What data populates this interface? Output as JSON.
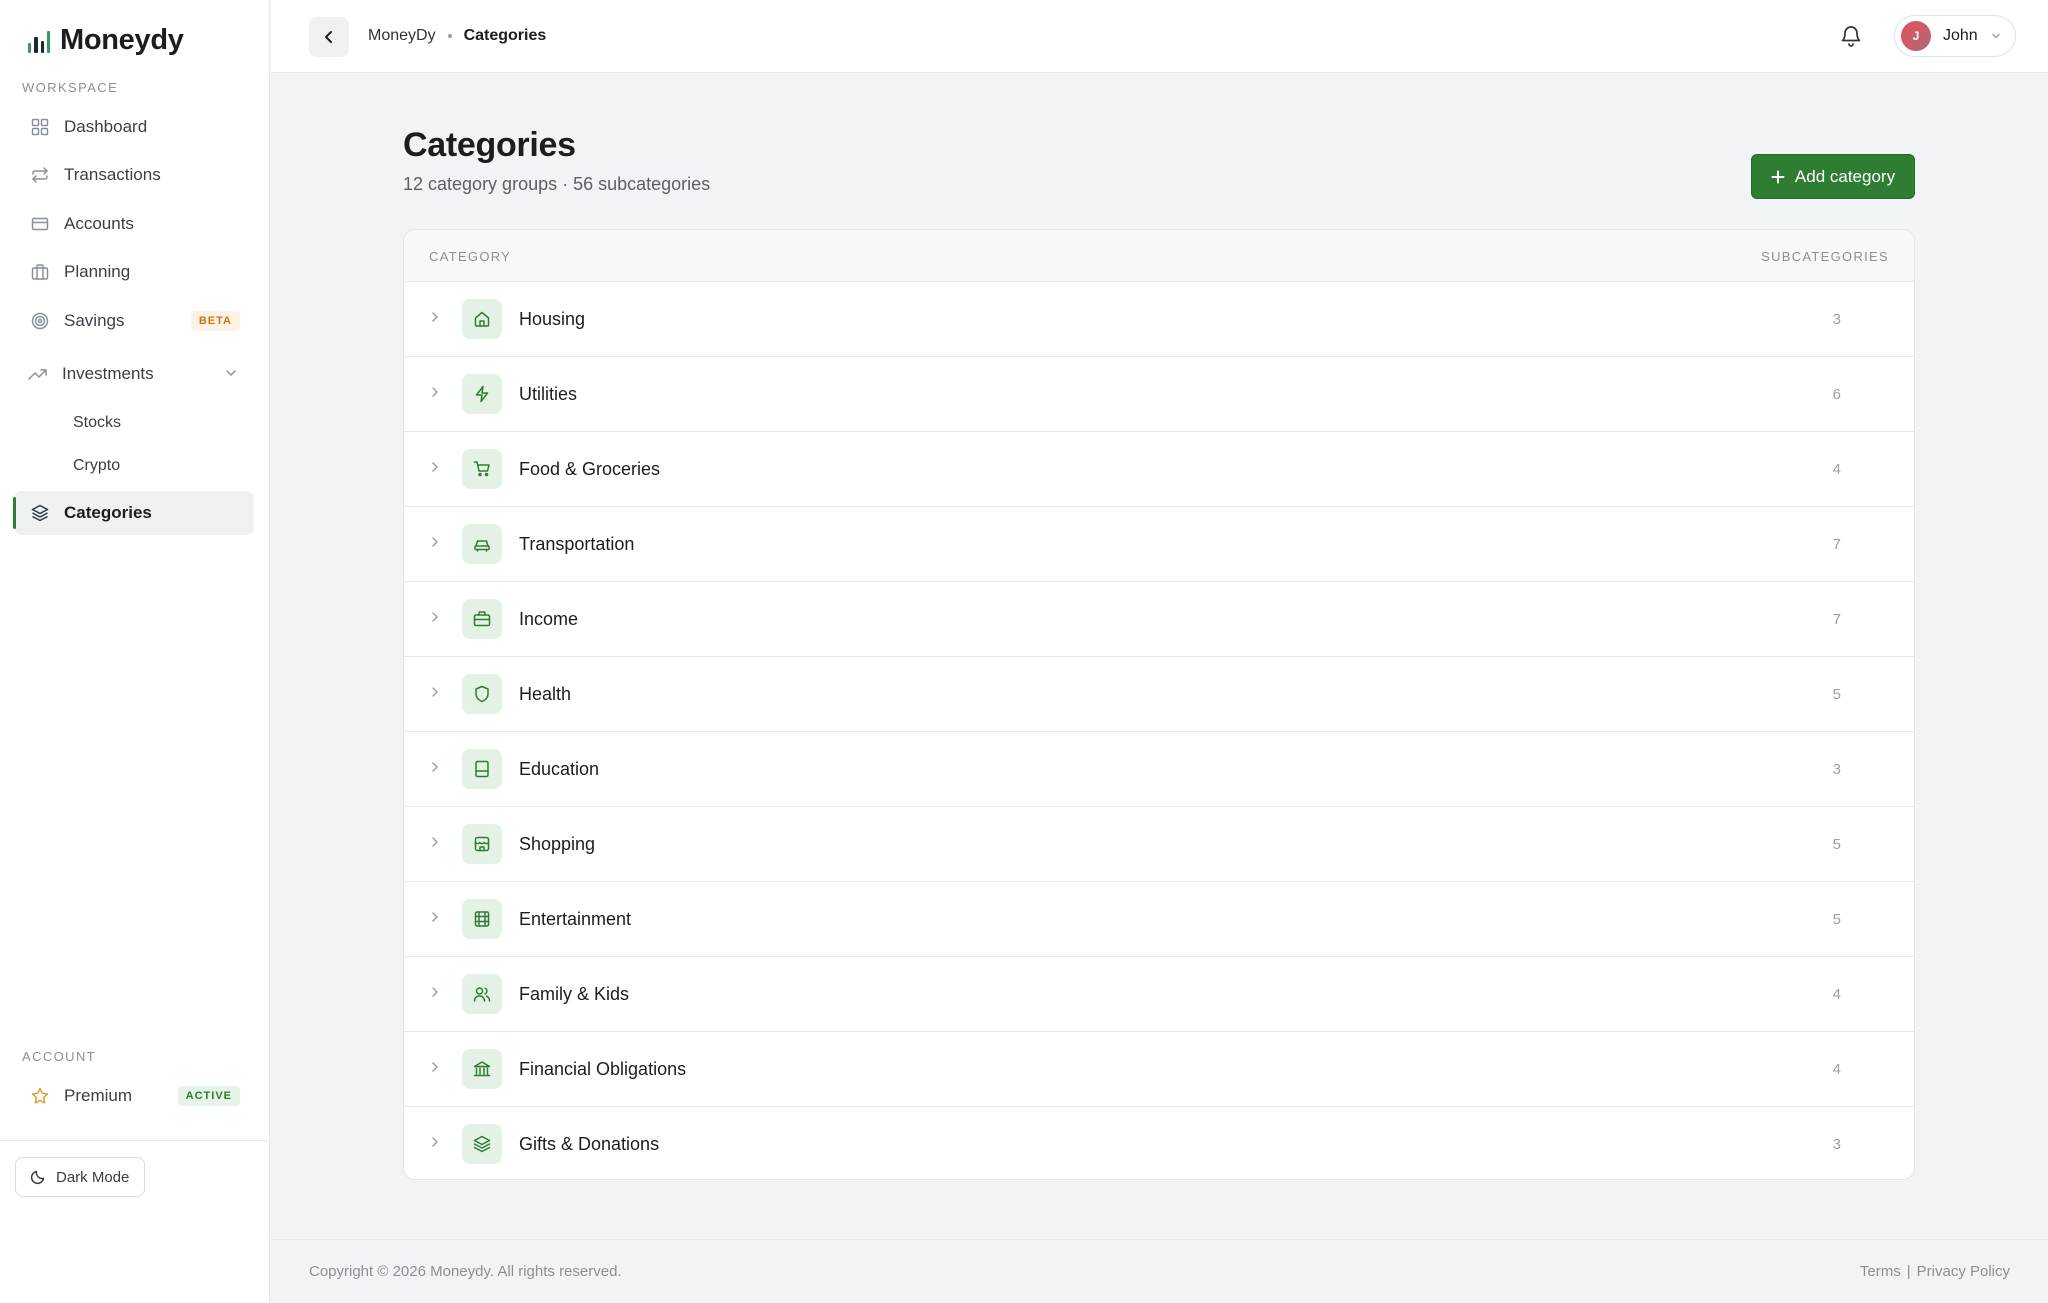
{
  "brand": {
    "name": "Moneydy"
  },
  "sidebar": {
    "workspace_label": "WORKSPACE",
    "items": [
      {
        "label": "Dashboard",
        "icon": "grid-icon"
      },
      {
        "label": "Transactions",
        "icon": "swap-icon"
      },
      {
        "label": "Accounts",
        "icon": "credit-card-icon"
      },
      {
        "label": "Planning",
        "icon": "briefcase-icon"
      },
      {
        "label": "Savings",
        "icon": "target-icon",
        "badge": "BETA"
      },
      {
        "label": "Investments",
        "icon": "trending-up-icon"
      }
    ],
    "investments_sub": [
      "Stocks",
      "Crypto"
    ],
    "active_item": "Categories",
    "account_label": "ACCOUNT",
    "premium_label": "Premium",
    "premium_badge": "ACTIVE",
    "dark_mode_label": "Dark Mode"
  },
  "header": {
    "breadcrumb": [
      "MoneyDy",
      "Categories"
    ],
    "user_initial": "J",
    "user_name": "John"
  },
  "page": {
    "title": "Categories",
    "subtitle": "12 category groups · 56 subcategories",
    "add_button": "Add category"
  },
  "table": {
    "col_category": "CATEGORY",
    "col_subcategories": "SUBCATEGORIES",
    "rows": [
      {
        "name": "Housing",
        "count": "3",
        "icon": "home-icon"
      },
      {
        "name": "Utilities",
        "count": "6",
        "icon": "bolt-icon"
      },
      {
        "name": "Food & Groceries",
        "count": "4",
        "icon": "cart-icon"
      },
      {
        "name": "Transportation",
        "count": "7",
        "icon": "car-icon"
      },
      {
        "name": "Income",
        "count": "7",
        "icon": "briefcase-icon"
      },
      {
        "name": "Health",
        "count": "5",
        "icon": "shield-icon"
      },
      {
        "name": "Education",
        "count": "3",
        "icon": "book-icon"
      },
      {
        "name": "Shopping",
        "count": "5",
        "icon": "store-icon"
      },
      {
        "name": "Entertainment",
        "count": "5",
        "icon": "film-icon"
      },
      {
        "name": "Family & Kids",
        "count": "4",
        "icon": "users-icon"
      },
      {
        "name": "Financial Obligations",
        "count": "4",
        "icon": "bank-icon"
      },
      {
        "name": "Gifts & Donations",
        "count": "3",
        "icon": "layers-icon"
      }
    ]
  },
  "footer": {
    "copyright": "Copyright © 2026 Moneydy. All rights reserved.",
    "terms": "Terms",
    "separator": "|",
    "privacy": "Privacy Policy"
  },
  "colors": {
    "accent": "#2e7d32",
    "icon_bg": "#e4f2e5",
    "beta": "#c7761a"
  }
}
